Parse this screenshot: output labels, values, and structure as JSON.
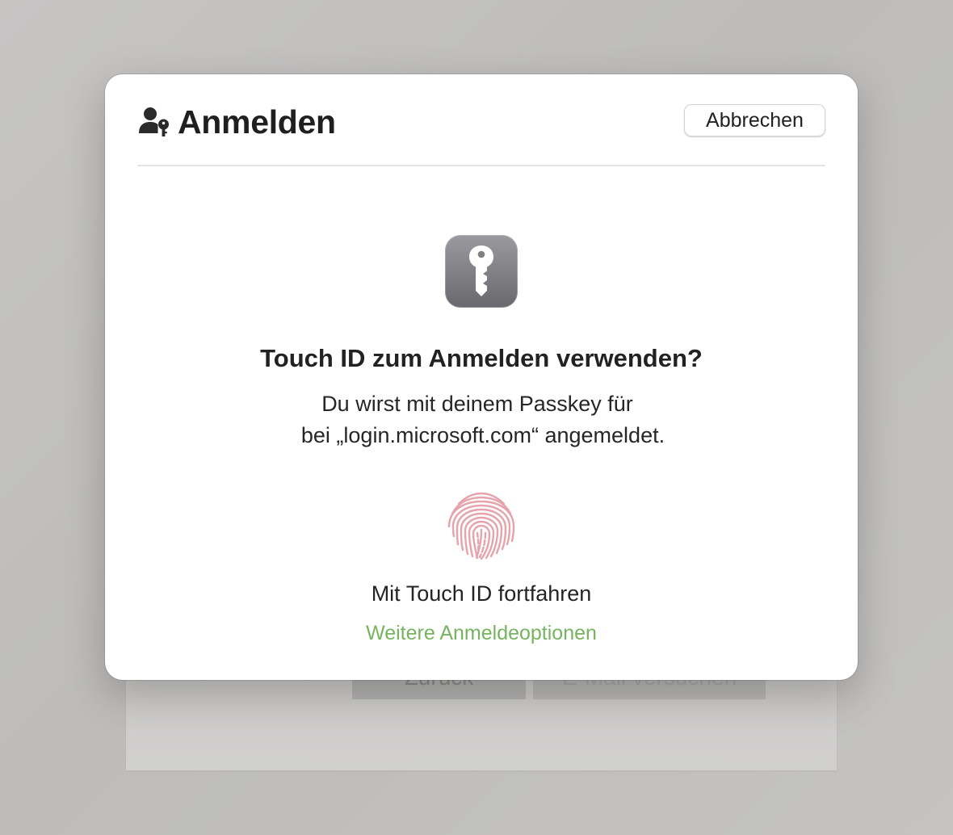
{
  "background": {
    "back_button_label": "Zurück",
    "email_button_label": "E-Mail versuchen"
  },
  "sheet": {
    "title": "Anmelden",
    "header_icon": "person-key-icon",
    "cancel_label": "Abbrechen",
    "app_icon": "passwords-key-icon",
    "heading": "Touch ID zum Anmelden verwenden?",
    "message_line1": "Du wirst mit deinem Passkey für",
    "message_line2": "bei „login.microsoft.com“ angemeldet.",
    "fingerprint_icon": "fingerprint-icon",
    "touch_id_label": "Mit Touch ID fortfahren",
    "more_options_label": "Weitere Anmeldeoptionen"
  },
  "colors": {
    "accent_link": "#76b45f",
    "fingerprint": "#e6a3ab",
    "icon_gray": "#7d7d82"
  }
}
